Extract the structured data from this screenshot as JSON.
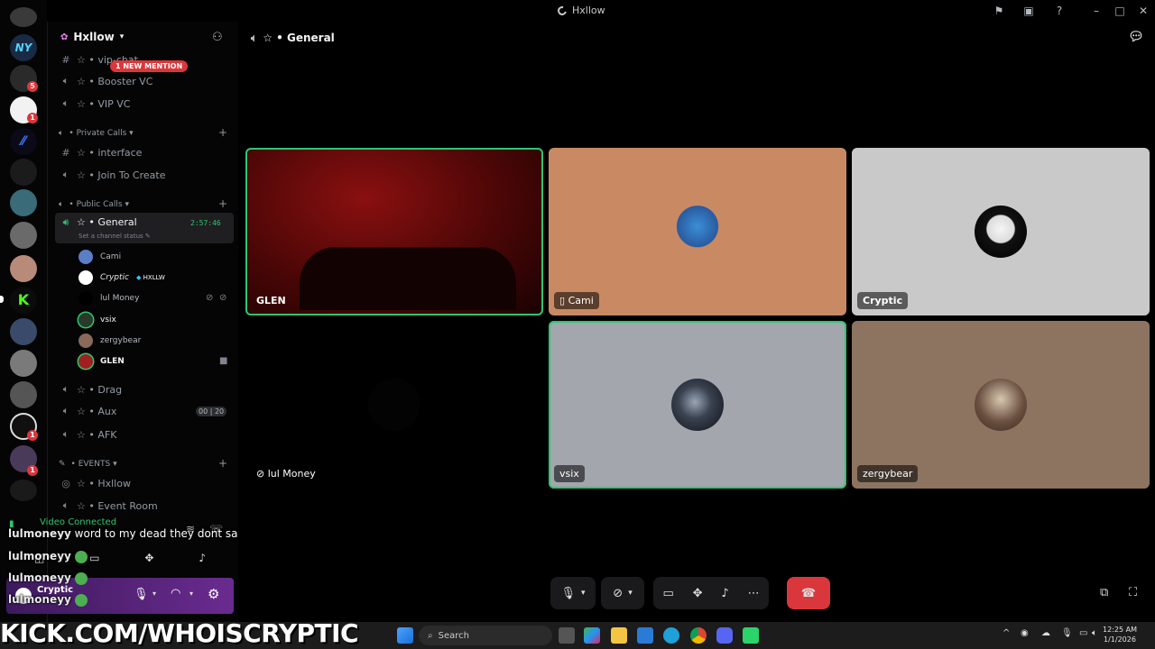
{
  "window": {
    "title": "Hxllow"
  },
  "server": {
    "name": "Hxllow",
    "mention_badge": "1 NEW MENTION"
  },
  "rail_badges": [
    "5",
    "1",
    "1",
    "1"
  ],
  "channels_top": [
    {
      "name": "vip-chat",
      "type": "text"
    },
    {
      "name": "Booster VC",
      "type": "voice"
    },
    {
      "name": "VIP VC",
      "type": "voice"
    }
  ],
  "categories": {
    "private": "Private Calls",
    "public": "Public Calls",
    "events": "EVENTS"
  },
  "private_channels": [
    {
      "name": "interface",
      "type": "text"
    },
    {
      "name": "Join To Create",
      "type": "voice"
    }
  ],
  "active_channel": {
    "name": "General",
    "timer": "2:57:46",
    "status": "Set a channel status"
  },
  "voice_members": [
    {
      "name": "Cami",
      "color": "#5b7ec9"
    },
    {
      "name": "Cryptic",
      "tag": "HXLLW",
      "color": "#ffffff"
    },
    {
      "name": "lul Money",
      "color": "#000000"
    },
    {
      "name": "vsix",
      "color": "#2a3a2a"
    },
    {
      "name": "zergybear",
      "color": "#8a6a5a"
    },
    {
      "name": "GLEN",
      "color": "#a02020"
    }
  ],
  "public_channels": [
    {
      "name": "Drag"
    },
    {
      "name": "Aux",
      "counts": [
        "00",
        "20"
      ]
    },
    {
      "name": "AFK"
    }
  ],
  "event_channels": [
    {
      "name": "Hxllow"
    },
    {
      "name": "Event Room"
    }
  ],
  "voice_status": "Video Connected",
  "chat_overlay": [
    {
      "nick": "lulmoneyy",
      "text": "word to my dead they dont say that shit"
    },
    {
      "nick": "lulmoneyy",
      "text": ""
    },
    {
      "nick": "lulmoneyy",
      "text": ""
    },
    {
      "nick": "lulmoneyy",
      "text": ""
    }
  ],
  "user": {
    "name": "Cryptic"
  },
  "main_header": {
    "channel": "General"
  },
  "tiles": [
    {
      "name": "GLEN",
      "kind": "video"
    },
    {
      "name": "Cami",
      "kind": "avatar",
      "bg": "#c98a63",
      "mobile": true
    },
    {
      "name": "Cryptic",
      "kind": "avatar",
      "bg": "#c9c9c9"
    },
    {
      "name": "lul Money",
      "kind": "empty"
    },
    {
      "name": "vsix",
      "kind": "avatar",
      "bg": "#a3a6ad"
    },
    {
      "name": "zergybear",
      "kind": "avatar",
      "bg": "#8c7460"
    }
  ],
  "banner": "KICK.COM/WHOISCRYPTIC",
  "taskbar": {
    "search": "Search",
    "time": "12:25 AM",
    "date": "1/1/2026"
  }
}
